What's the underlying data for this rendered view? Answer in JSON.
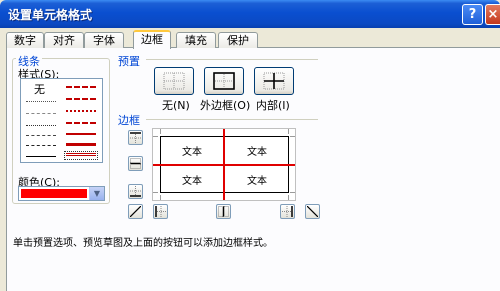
{
  "window": {
    "title": "设置单元格格式",
    "help_glyph": "?",
    "close_glyph": "×"
  },
  "tabs": [
    {
      "label": "数字"
    },
    {
      "label": "对齐"
    },
    {
      "label": "字体"
    },
    {
      "label": "边框",
      "active": true
    },
    {
      "label": "填充"
    },
    {
      "label": "保护"
    }
  ],
  "line": {
    "group_label": "线条",
    "style_label": "样式(S):",
    "none_style_label": "无",
    "color_label": "颜色(C):",
    "selected_color": "#FF0000"
  },
  "presets": {
    "section_label": "预置",
    "none_label": "无(N)",
    "outline_label": "外边框(O)",
    "inside_label": "内部(I)"
  },
  "border": {
    "section_label": "边框",
    "preview_cell_text": "文本",
    "line_color": "#E00000"
  },
  "hint_text": "单击预置选项、预览草图及上面的按钮可以添加边框样式。"
}
